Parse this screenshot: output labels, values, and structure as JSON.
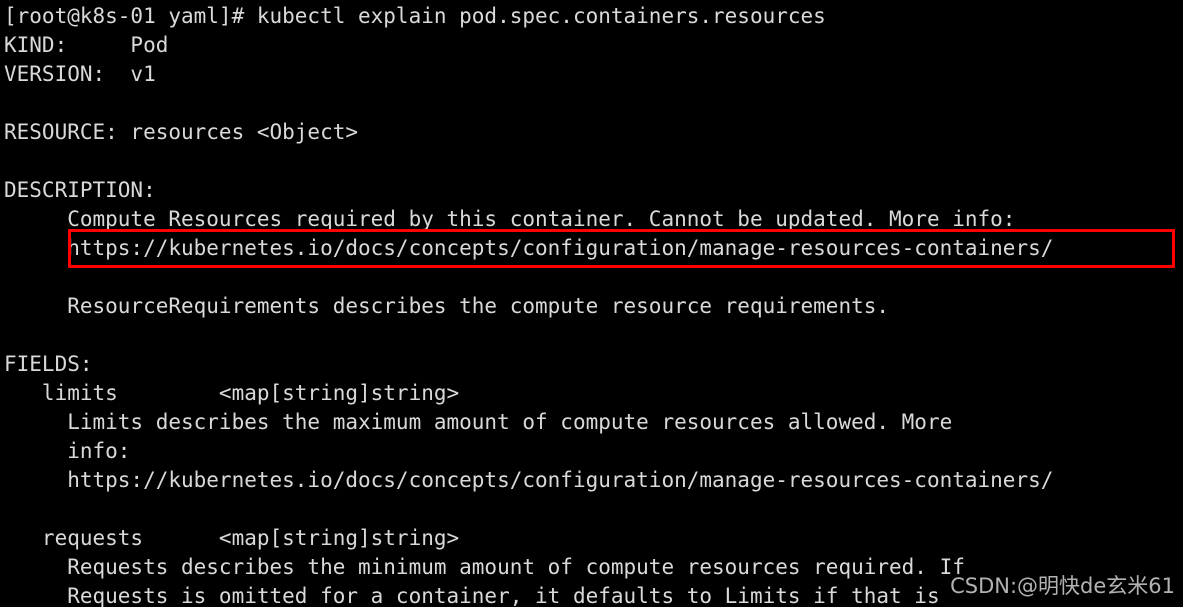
{
  "terminal": {
    "background_color": "#000000",
    "text_color": "#d9d9d9",
    "prompt": "[root@k8s-01 yaml]# ",
    "command": "kubectl explain pod.spec.containers.resources",
    "lines": [
      "[root@k8s-01 yaml]# kubectl explain pod.spec.containers.resources",
      "KIND:     Pod",
      "VERSION:  v1",
      "",
      "RESOURCE: resources <Object>",
      "",
      "DESCRIPTION:",
      "     Compute Resources required by this container. Cannot be updated. More info:",
      "     https://kubernetes.io/docs/concepts/configuration/manage-resources-containers/",
      "",
      "     ResourceRequirements describes the compute resource requirements.",
      "",
      "FIELDS:",
      "   limits\t<map[string]string>",
      "     Limits describes the maximum amount of compute resources allowed. More",
      "     info:",
      "     https://kubernetes.io/docs/concepts/configuration/manage-resources-containers/",
      "",
      "   requests\t<map[string]string>",
      "     Requests describes the minimum amount of compute resources required. If",
      "     Requests is omitted for a container, it defaults to Limits if that is"
    ],
    "rows": {
      "prompt_line": "[root@k8s-01 yaml]# kubectl explain pod.spec.containers.resources",
      "kind_label": "KIND:",
      "kind_value": "Pod",
      "kind_line": "KIND:     Pod",
      "version_label": "VERSION:",
      "version_value": "v1",
      "version_line": "VERSION:  v1",
      "resource_label": "RESOURCE:",
      "resource_value": "resources <Object>",
      "resource_line": "RESOURCE: resources <Object>",
      "description_label": "DESCRIPTION:",
      "description_line_1": "     Compute Resources required by this container. Cannot be updated. More info:",
      "description_url": "     https://kubernetes.io/docs/concepts/configuration/manage-resources-containers/",
      "description_line_3": "     ResourceRequirements describes the compute resource requirements.",
      "fields_label": "FIELDS:",
      "limits_row": "   limits        <map[string]string>",
      "limits_desc_1": "     Limits describes the maximum amount of compute resources allowed. More",
      "limits_desc_2": "     info:",
      "limits_url": "     https://kubernetes.io/docs/concepts/configuration/manage-resources-containers/",
      "requests_row": "   requests      <map[string]string>",
      "requests_desc_1": "     Requests describes the minimum amount of compute resources required. If",
      "requests_desc_2": "     Requests is omitted for a container, it defaults to Limits if that is"
    }
  },
  "annotation": {
    "type": "rectangle-highlight",
    "color": "#fe0000",
    "target_text": "https://kubernetes.io/docs/concepts/configuration/manage-resources-containers/"
  },
  "watermark": {
    "text": "CSDN:@明快de玄米61",
    "color": "#e4e4e4"
  }
}
